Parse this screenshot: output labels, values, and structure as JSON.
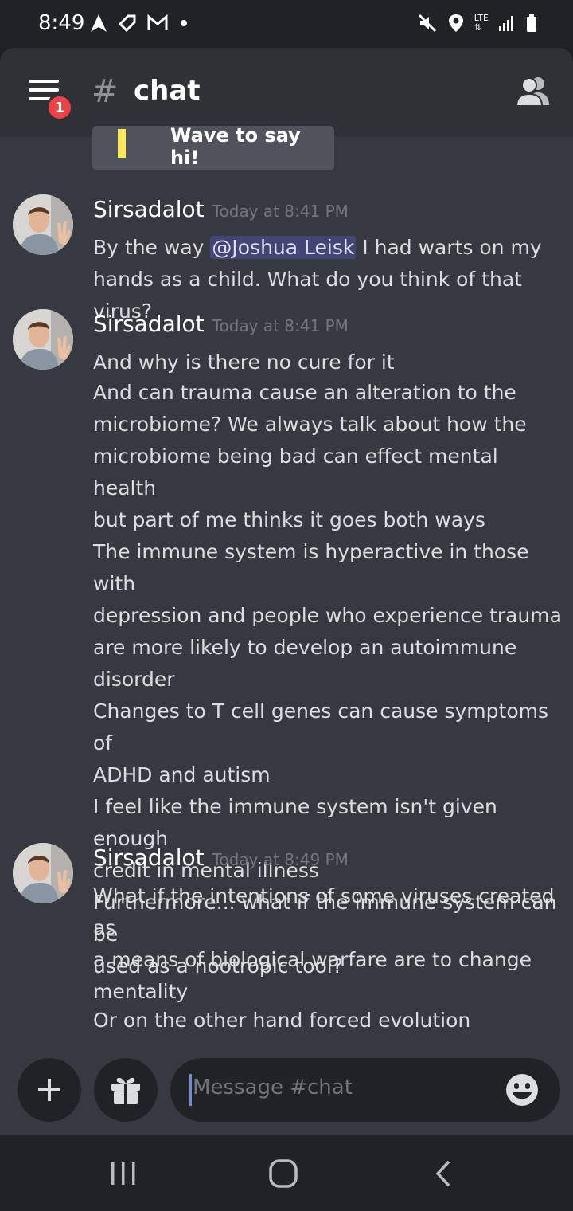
{
  "status_bar": {
    "time": "8:49",
    "left_icons": [
      "navigation-icon",
      "tag-icon",
      "gmail-icon",
      "dot-icon"
    ],
    "right_icons": [
      "mute-icon",
      "location-icon",
      "lte-icon",
      "signal-icon",
      "battery-icon"
    ],
    "network_label": "LTE"
  },
  "header": {
    "badge_count": "1",
    "hash_symbol": "#",
    "channel_name": "chat"
  },
  "wave_card": {
    "label": "Wave to say hi!"
  },
  "messages": [
    {
      "author": "Sirsadalot",
      "timestamp": "Today at 8:41 PM",
      "lines": [
        "By the way ",
        "@Joshua Leisk",
        " I had warts on my",
        "hands as a child. What do you think of that virus?"
      ]
    },
    {
      "author": "Sirsadalot",
      "timestamp": "Today at 8:41 PM",
      "lines": [
        "And why is there no cure for it",
        "And can trauma cause an alteration to the",
        "microbiome? We always talk about how the",
        "microbiome being bad can effect mental health",
        "but part of me thinks it goes both ways",
        "The immune system is hyperactive in those with",
        "depression and people who experience trauma",
        "are more likely to develop an autoimmune",
        "disorder",
        "Changes to T cell genes can cause symptoms of",
        "ADHD and autism",
        "I feel like the immune system isn't given enough",
        "credit in mental illness",
        "Furthermore... what if the immune system can be",
        "used as a nootropic tool?"
      ]
    },
    {
      "author": "Sirsadalot",
      "timestamp": "Today at 8:49 PM",
      "lines": [
        "What if the intentions of some viruses created as",
        "a means of biological warfare are to change",
        "mentality",
        "Or on the other hand forced evolution"
      ]
    }
  ],
  "composer": {
    "placeholder": "Message #chat"
  },
  "colors": {
    "background": "#36393f",
    "header": "#2f3136",
    "mention": "#414675",
    "badge": "#ed4245",
    "wave_bar": "#fee75c"
  }
}
